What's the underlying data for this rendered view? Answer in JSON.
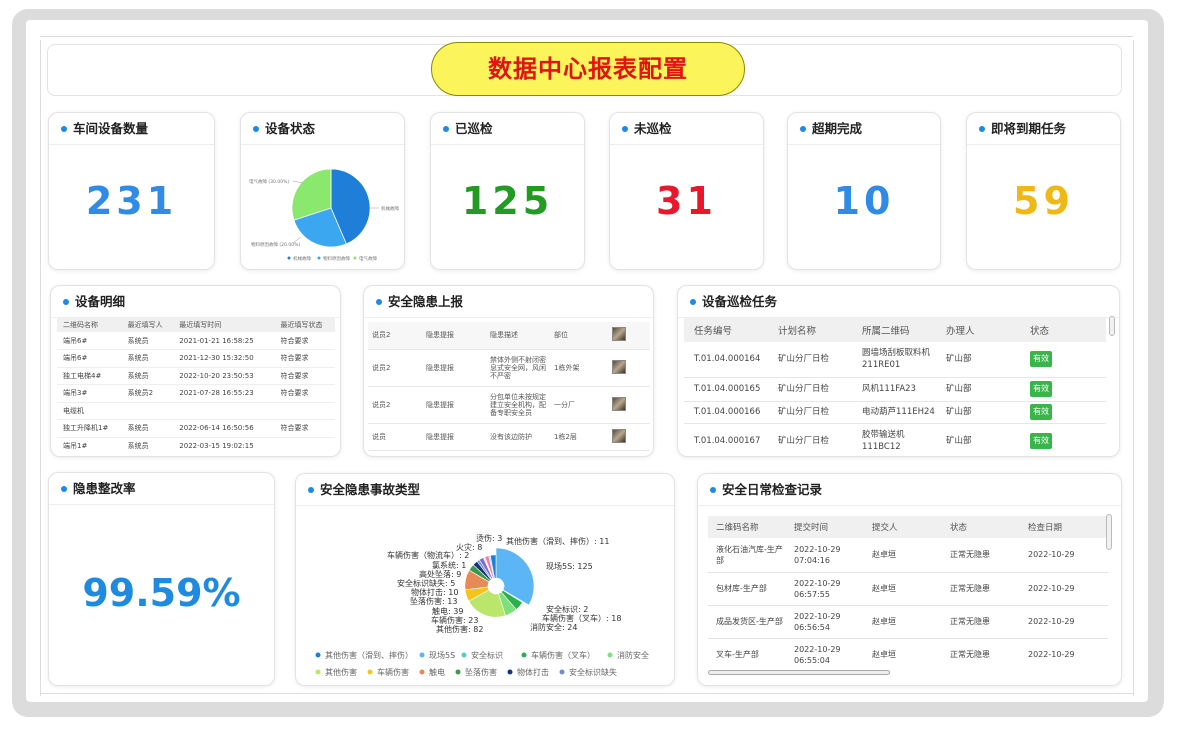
{
  "title": "数据中心报表配置",
  "stats": [
    {
      "label": "车间设备数量",
      "value": "231",
      "color": "#2f8be6"
    },
    {
      "label": "设备状态"
    },
    {
      "label": "已巡检",
      "value": "125",
      "color": "#239a23"
    },
    {
      "label": "未巡检",
      "value": "31",
      "color": "#e8172c"
    },
    {
      "label": "超期完成",
      "value": "10",
      "color": "#2f8be6"
    },
    {
      "label": "即将到期任务",
      "value": "59",
      "color": "#f0b816"
    }
  ],
  "device_status_chart": {
    "labels": [
      "电气故障 (30.00%)",
      "机械故障",
      "物料原因故障 (20.00%)"
    ],
    "legend": [
      "机械故障",
      "物料原因故障",
      "电气故障"
    ],
    "colors": [
      "#1f7fd8",
      "#3ba7f0",
      "#8ae86e"
    ]
  },
  "device_detail": {
    "title": "设备明细",
    "columns": [
      "二维码名称",
      "最近填写人",
      "最近填写时间",
      "最近填写状态"
    ],
    "rows": [
      [
        "端吊6#",
        "系统员",
        "2021-01-21 16:58:25",
        "符合要求"
      ],
      [
        "端吊6#",
        "系统员",
        "2021-12-30 15:32:50",
        "符合要求"
      ],
      [
        "独工电梯4#",
        "系统员",
        "2022-10-20 23:50:53",
        "符合要求"
      ],
      [
        "端吊3#",
        "系统员2",
        "2021-07-28 16:55:23",
        "符合要求"
      ],
      [
        "电缆机",
        "",
        "",
        ""
      ],
      [
        "独工升降机1#",
        "系统员",
        "2022-06-14 16:50:56",
        "符合要求"
      ],
      [
        "端吊1#",
        "系统员",
        "2022-03-15 19:02:15",
        ""
      ]
    ]
  },
  "hazard_report": {
    "title": "安全隐患上报",
    "rows": [
      {
        "who": "说员2",
        "link": "隐患提报",
        "desc": "隐患描述",
        "loc": "部位"
      },
      {
        "who": "说员2",
        "link": "隐患提报",
        "desc": "禁体外侧不射闭密息式安全网，风闲不严密",
        "loc": "1栋外架"
      },
      {
        "who": "说员2",
        "link": "隐患提报",
        "desc": "分包单位未按规定建立安全机构，配备专职安全员",
        "loc": "一分厂"
      },
      {
        "who": "说员",
        "link": "隐患提报",
        "desc": "没有该边防护",
        "loc": "1栋2层"
      }
    ]
  },
  "inspection_tasks": {
    "title": "设备巡检任务",
    "columns": [
      "任务编号",
      "计划名称",
      "所属二维码",
      "办理人",
      "状态"
    ],
    "rows": [
      [
        "T.01.04.000164",
        "矿山分厂日检",
        "圆墙场刮板取料机211RE01",
        "矿山部",
        "有效"
      ],
      [
        "T.01.04.000165",
        "矿山分厂日检",
        "风机111FA23",
        "矿山部",
        "有效"
      ],
      [
        "T.01.04.000166",
        "矿山分厂日检",
        "电动葫芦111EH24",
        "矿山部",
        "有效"
      ],
      [
        "T.01.04.000167",
        "矿山分厂日检",
        "胶带输送机111BC12",
        "矿山部",
        "有效"
      ]
    ]
  },
  "rectify_rate": {
    "title": "隐患整改率",
    "value": "99.59%"
  },
  "hazard_types": {
    "title": "安全隐患事故类型",
    "labels": [
      "烫伤: 3",
      "火灾: 8",
      "车辆伤害（物流车）: 2",
      "氯系统: 1",
      "高处坠落: 9",
      "安全标识缺失: 5",
      "物体打击: 10",
      "坠落伤害: 13",
      "触电: 39",
      "车辆伤害: 23",
      "其他伤害: 82",
      "消防安全: 24",
      "车辆伤害（叉车）: 18",
      "安全标识: 2",
      "现场5S: 125",
      "其他伤害（滑到、摔伤）: 11"
    ],
    "legend": [
      {
        "name": "其他伤害（滑到、摔伤）",
        "color": "#1f7fd8"
      },
      {
        "name": "现场5S",
        "color": "#5cb5f5"
      },
      {
        "name": "安全标识",
        "color": "#49d3c2"
      },
      {
        "name": "车辆伤害（叉车）",
        "color": "#2bb14b"
      },
      {
        "name": "消防安全",
        "color": "#7ee07a"
      },
      {
        "name": "其他伤害",
        "color": "#b9e66b"
      },
      {
        "name": "车辆伤害",
        "color": "#f3c41b"
      },
      {
        "name": "触电",
        "color": "#e88a57"
      },
      {
        "name": "坠落伤害",
        "color": "#3a9a4a"
      },
      {
        "name": "物体打击",
        "color": "#17337a"
      },
      {
        "name": "安全标识缺失",
        "color": "#6a8fd8"
      }
    ]
  },
  "daily_check": {
    "title": "安全日常检查记录",
    "columns": [
      "二维码名称",
      "提交时间",
      "提交人",
      "状态",
      "检查日期"
    ],
    "rows": [
      [
        "液化石油汽库-生产部",
        "2022-10-29 07:04:16",
        "赵卓垣",
        "正常无隐患",
        "2022-10-29"
      ],
      [
        "包材库-生产部",
        "2022-10-29 06:57:55",
        "赵卓垣",
        "正常无隐患",
        "2022-10-29"
      ],
      [
        "成品发货区-生产部",
        "2022-10-29 06:56:54",
        "赵卓垣",
        "正常无隐患",
        "2022-10-29"
      ],
      [
        "叉车-生产部",
        "2022-10-29 06:55:04",
        "赵卓垣",
        "正常无隐患",
        "2022-10-29"
      ]
    ]
  }
}
